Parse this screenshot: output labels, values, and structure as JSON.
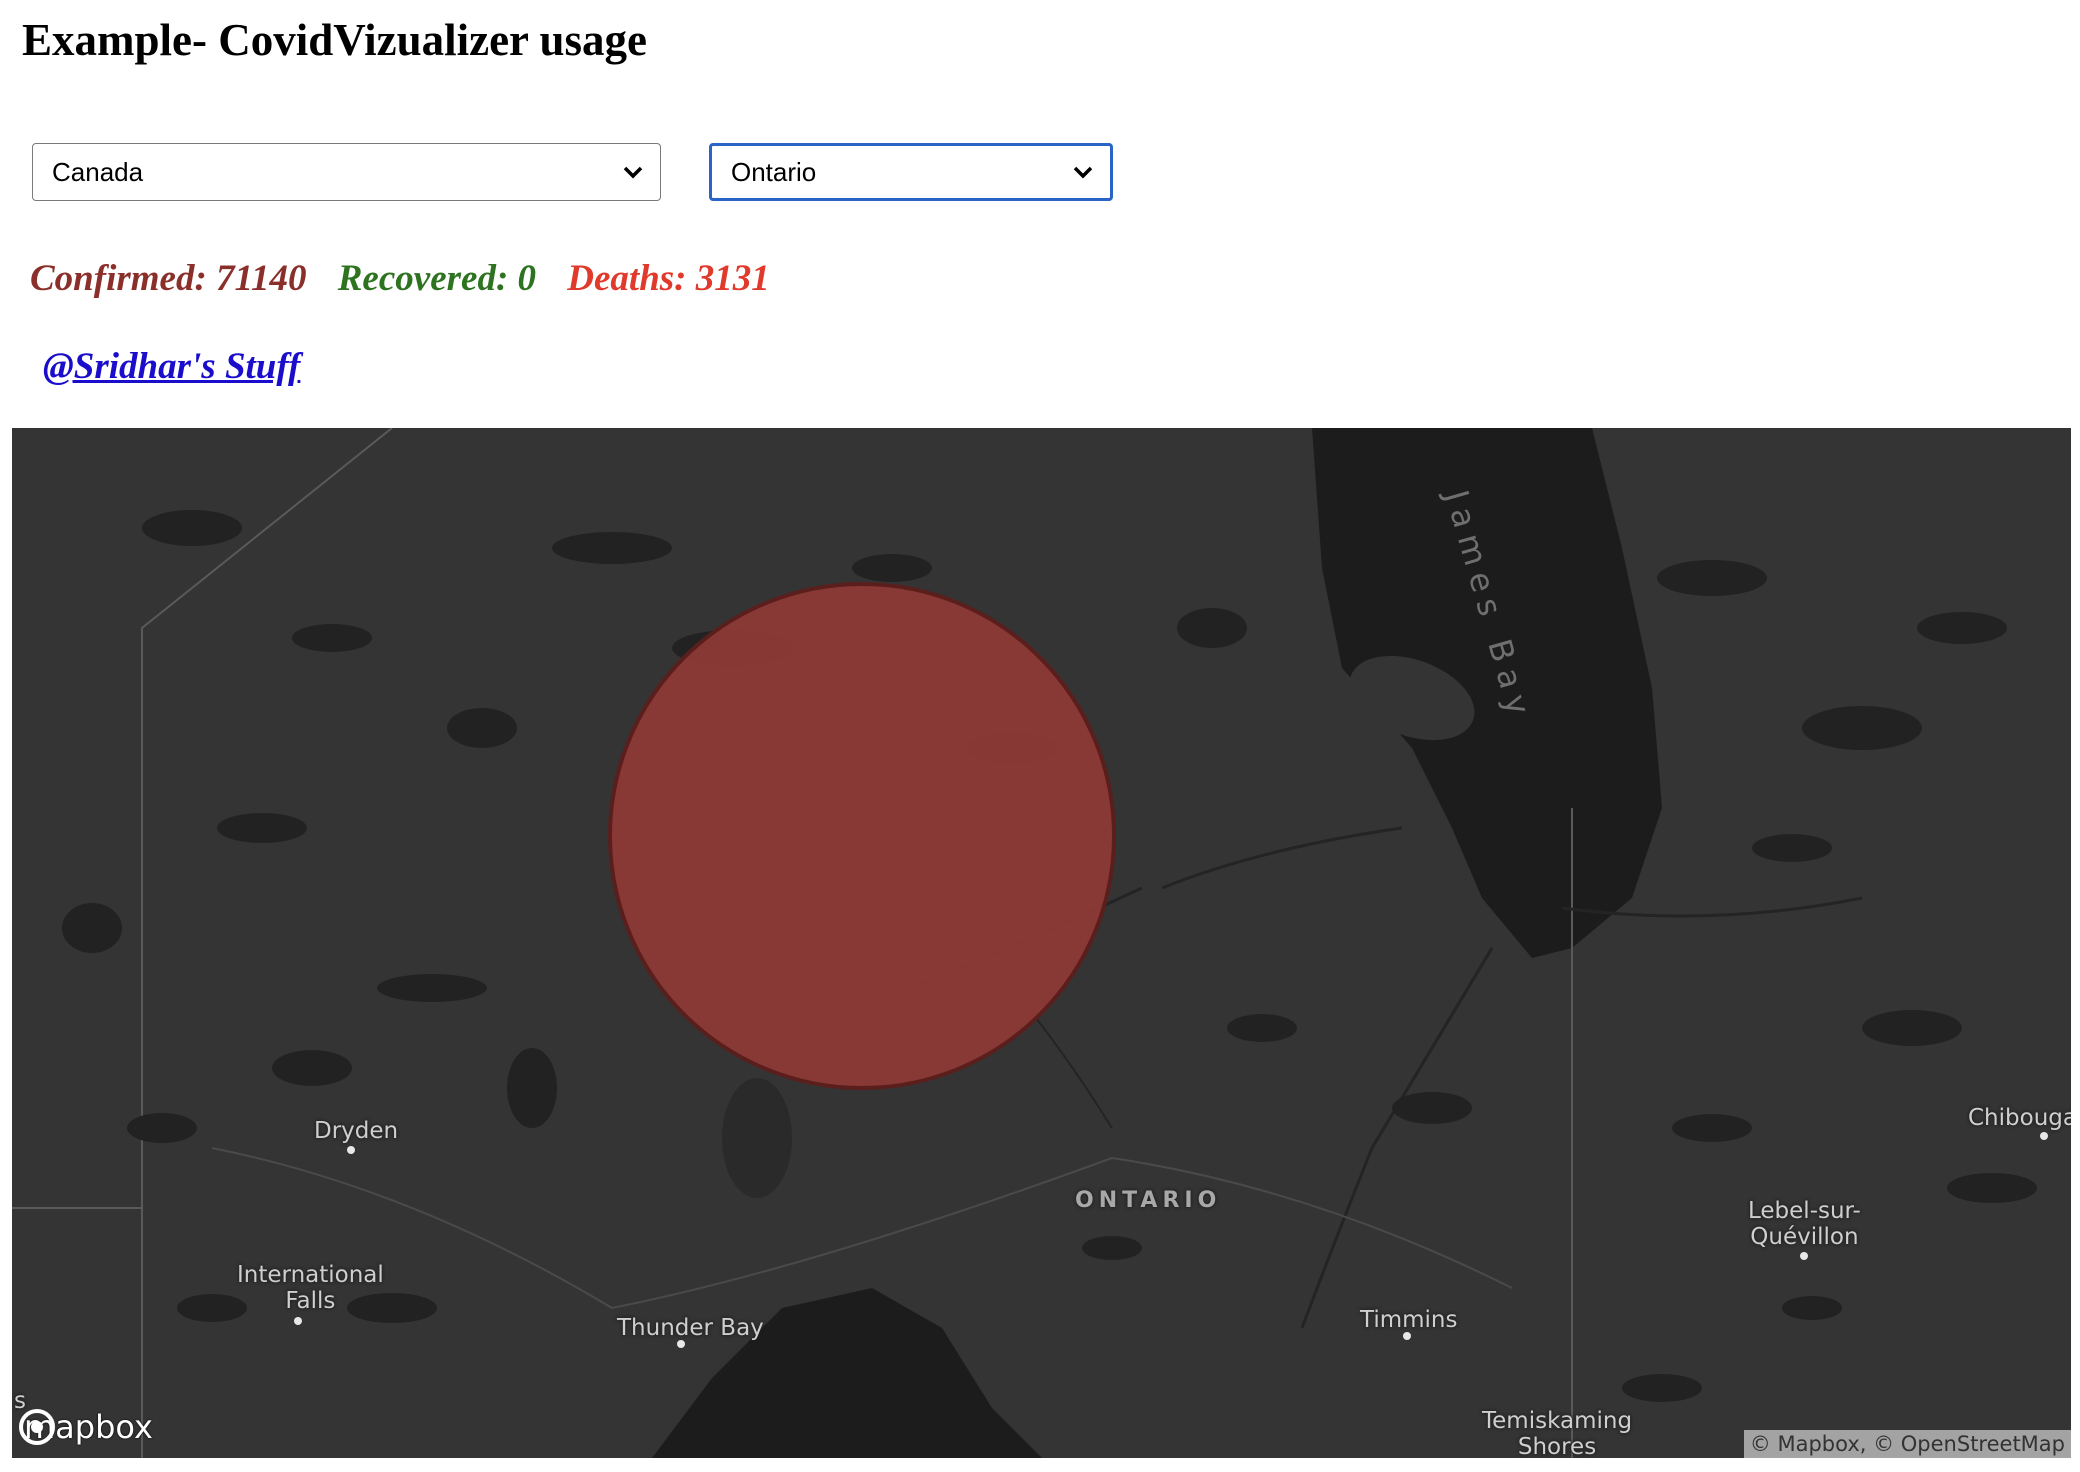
{
  "page": {
    "title": "Example- CovidVizualizer usage"
  },
  "filters": {
    "country": {
      "selected": "Canada"
    },
    "region": {
      "selected": "Ontario"
    }
  },
  "stats": {
    "confirmed": "Confirmed: 71140",
    "recovered": "Recovered: 0",
    "deaths": "Deaths: 3131"
  },
  "author_link": "@Sridhar's Stuff",
  "map": {
    "water_label": "James Bay",
    "region_label": "ONTARIO",
    "places": {
      "dryden": "Dryden",
      "international_falls": "International\nFalls",
      "thunder_bay": "Thunder Bay",
      "timmins": "Timmins",
      "lebel": "Lebel-sur-\nQuévillon",
      "chibougamau": "Chibouga",
      "temiskaming": "Temiskaming\nShores",
      "edge_fragment": "s"
    },
    "logo_text": "mapbox",
    "attribution": "© Mapbox, © OpenStreetMap",
    "marker_color": "#8e3a36",
    "land_color": "#343434",
    "water_color": "#1c1c1c"
  }
}
